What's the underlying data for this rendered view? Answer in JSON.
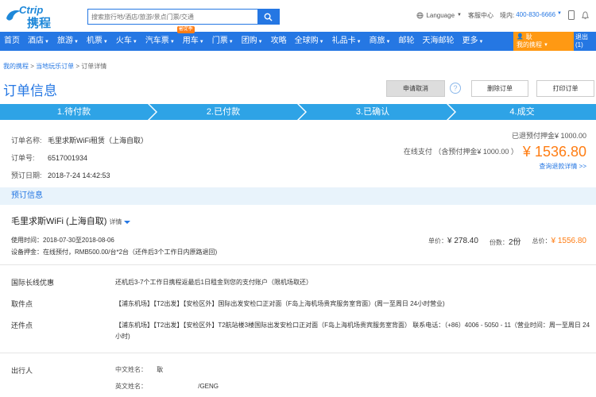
{
  "header": {
    "logo_en": "Ctrip",
    "logo_cn": "携程",
    "search_placeholder": "搜索旅行地/酒店/旅游/景点门票/交通",
    "language": "Language",
    "service": "客服中心",
    "region": "境内:",
    "phone": "400-830-6666"
  },
  "nav": {
    "items": [
      "首页",
      "酒店",
      "旅游",
      "机票",
      "火车",
      "汽车票",
      "用车",
      "门票",
      "团购",
      "攻略",
      "全球购",
      "礼品卡",
      "商旅",
      "邮轮",
      "天海邮轮",
      "更多"
    ],
    "badge": "暑促季",
    "user_name": "耿",
    "my_trip": "我的携程",
    "msg_count": "(1)",
    "logout": "退出"
  },
  "breadcrumb": {
    "home": "我的携程",
    "parent": "当地玩乐订单",
    "current": "订单详情"
  },
  "page": {
    "title": "订单信息",
    "cancel_btn": "申请取消",
    "help": "?",
    "delete_btn": "删除订单",
    "print_btn": "打印订单"
  },
  "steps": [
    "1.待付款",
    "2.已付款",
    "3.已确认",
    "4.成交"
  ],
  "order": {
    "name_label": "订单名称:",
    "name": "毛里求斯WiFi租赁（上海自取）",
    "no_label": "订单号:",
    "no": "6517001934",
    "date_label": "预订日期:",
    "date": "2018-7-24 14:42:53",
    "deposit_note": "已退预付押金¥ 1000.00",
    "pay_note": "在线支付 （含预付押金¥ 1000.00 ）",
    "total": "¥ 1536.80",
    "refund_link": "查询退款详情 >>"
  },
  "booking": {
    "section_title": "预订信息",
    "product": "毛里求斯WiFi (上海自取)",
    "details": "详情",
    "use_time": "使用时间：2018-07-30至2018-08-06",
    "deposit": "设备押金：在线预付，RMB500.00/台*2台（还件后3个工作日内原路退回)",
    "unit_label": "单价：",
    "unit_price": "¥ 278.40",
    "qty_label": "份数：",
    "qty": "2份",
    "total_label": "总价：",
    "total": "¥ 1556.80"
  },
  "rows": [
    {
      "label": "国际长线优惠",
      "value": "还机后3-7个工作日携程返最后1日租金到您的支付账户（限机场取还）"
    },
    {
      "label": "取件点",
      "value": "【浦东机场】【T2出发】【安检区外】国际出发安检口正对面（F岛上海机场贵宾服务室背面）(周一至周日 24小时营业)"
    },
    {
      "label": "还件点",
      "value": "【浦东机场】【T2出发】【安检区外】T2航站楼3楼国际出发安检口正对面（F岛上海机场贵宾服务室背面） 联系电话：（+86）4006 - 5050 - 11（营业时间：周一至周日 24小时)"
    }
  ],
  "traveler": {
    "label": "出行人",
    "cn_name_label": "中文姓名：",
    "cn_name": "耿",
    "en_name_label": "英文姓名：",
    "en_name": "/GENG"
  },
  "colors": {
    "brand": "#2577e3",
    "step": "#2ea3e6",
    "price": "#ff7d13",
    "section_bg": "#e8f3fb"
  }
}
